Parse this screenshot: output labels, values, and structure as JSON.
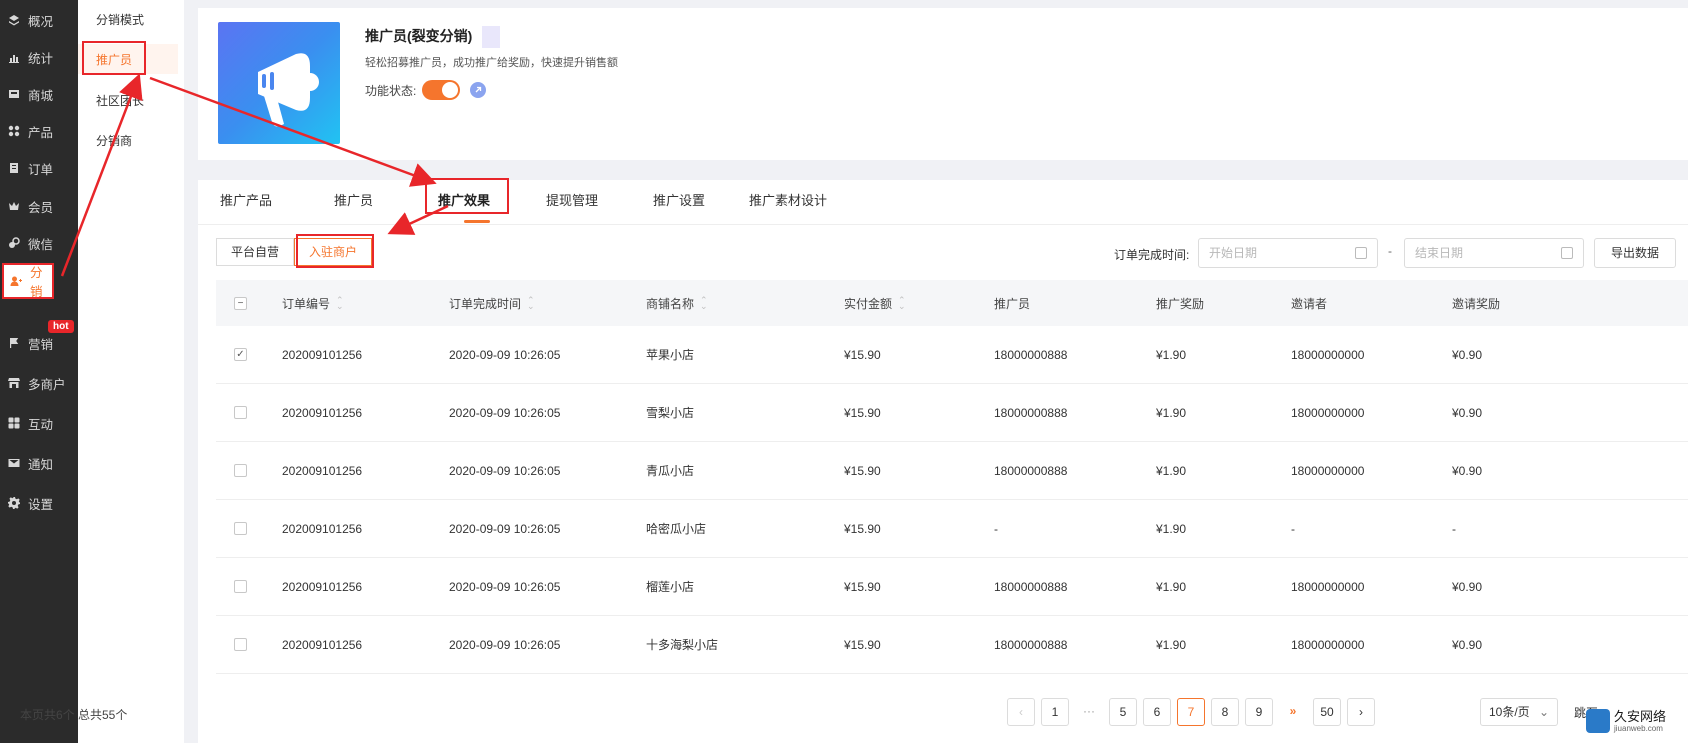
{
  "sidebar": {
    "items": [
      {
        "label": "概况",
        "icon": "layers-icon"
      },
      {
        "label": "统计",
        "icon": "chart-icon"
      },
      {
        "label": "商城",
        "icon": "store-icon"
      },
      {
        "label": "产品",
        "icon": "grid-icon"
      },
      {
        "label": "订单",
        "icon": "order-icon"
      },
      {
        "label": "会员",
        "icon": "crown-icon"
      },
      {
        "label": "微信",
        "icon": "wechat-icon"
      },
      {
        "label": "分销",
        "icon": "distribution-icon"
      },
      {
        "label": "营销",
        "icon": "flag-icon"
      },
      {
        "label": "多商户",
        "icon": "shop-icon"
      },
      {
        "label": "互动",
        "icon": "grid-icon"
      },
      {
        "label": "通知",
        "icon": "mail-icon"
      },
      {
        "label": "设置",
        "icon": "gear-icon"
      }
    ],
    "hot_badge": "hot"
  },
  "submenu": {
    "items": [
      "分销模式",
      "推广员",
      "社区团长",
      "分销商"
    ]
  },
  "header": {
    "title": "推广员(裂变分销)",
    "description": "轻松招募推广员，成功推广给奖励，快速提升销售额",
    "status_label": "功能状态:"
  },
  "tabs": [
    "推广产品",
    "推广员",
    "推广效果",
    "提现管理",
    "推广设置",
    "推广素材设计"
  ],
  "filters": {
    "segments": [
      "平台自营",
      "入驻商户"
    ],
    "date_label": "订单完成时间:",
    "start_placeholder": "开始日期",
    "end_placeholder": "结束日期",
    "separator": "-",
    "export_label": "导出数据"
  },
  "table": {
    "headers": [
      "订单编号",
      "订单完成时间",
      "商铺名称",
      "实付金额",
      "推广员",
      "推广奖励",
      "邀请者",
      "邀请奖励"
    ],
    "rows": [
      [
        "202009101256",
        "2020-09-09 10:26:05",
        "苹果小店",
        "¥15.90",
        "18000000888",
        "¥1.90",
        "18000000000",
        "¥0.90"
      ],
      [
        "202009101256",
        "2020-09-09 10:26:05",
        "雪梨小店",
        "¥15.90",
        "18000000888",
        "¥1.90",
        "18000000000",
        "¥0.90"
      ],
      [
        "202009101256",
        "2020-09-09 10:26:05",
        "青瓜小店",
        "¥15.90",
        "18000000888",
        "¥1.90",
        "18000000000",
        "¥0.90"
      ],
      [
        "202009101256",
        "2020-09-09 10:26:05",
        "哈密瓜小店",
        "¥15.90",
        "-",
        "¥1.90",
        "-",
        "-"
      ],
      [
        "202009101256",
        "2020-09-09 10:26:05",
        "榴莲小店",
        "¥15.90",
        "18000000888",
        "¥1.90",
        "18000000000",
        "¥0.90"
      ],
      [
        "202009101256",
        "2020-09-09 10:26:05",
        "十多海梨小店",
        "¥15.90",
        "18000000888",
        "¥1.90",
        "18000000000",
        "¥0.90"
      ]
    ]
  },
  "footer": {
    "summary": "本页共6个  总共55个",
    "pages": [
      "1",
      "···",
      "5",
      "6",
      "7",
      "8",
      "9",
      "»",
      "50"
    ],
    "current_page": "7",
    "page_size": "10条/页",
    "jump_label": "跳至"
  },
  "watermark": {
    "text": "久安网络",
    "sub": "jiuanweb.com"
  },
  "colors": {
    "accent": "#f5752d",
    "annotation": "#e8262a",
    "rail": "#2b2b2b"
  }
}
